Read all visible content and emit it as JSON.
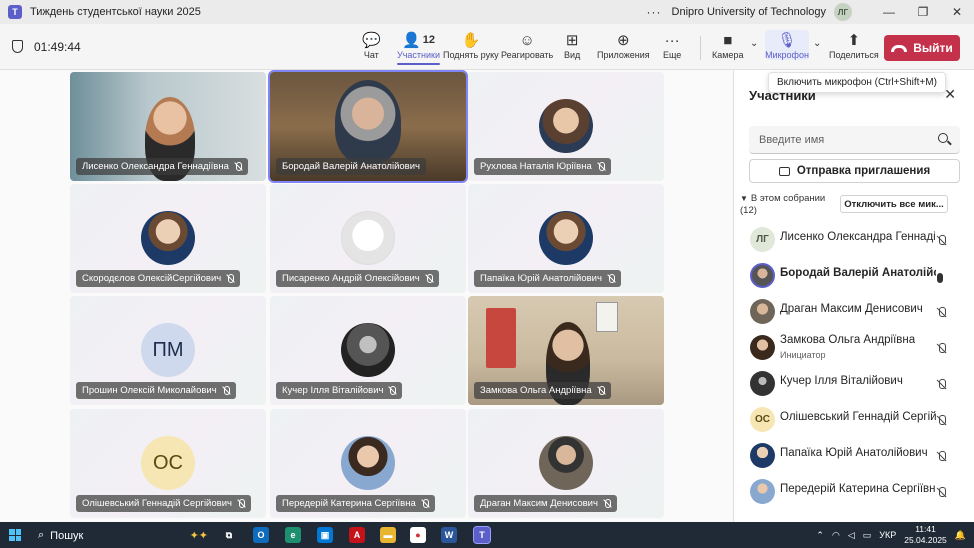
{
  "window": {
    "title": "Тиждень студентської науки 2025",
    "org": "Dnipro University of Technology",
    "user_initials": "ЛГ"
  },
  "toolbar": {
    "timer": "01:49:44",
    "chat": "Чат",
    "participants": "Участники",
    "participants_count": "12",
    "raise_hand": "Поднять руку",
    "react": "Реагировать",
    "view": "Вид",
    "apps": "Приложения",
    "more": "Еще",
    "camera": "Камера",
    "mic": "Микрофон",
    "share": "Поделиться",
    "leave": "Выйти"
  },
  "tooltip": "Включить микрофон (Ctrl+Shift+M)",
  "tiles": [
    {
      "name": "Лисенко Олександра Геннадіївна"
    },
    {
      "name": "Бородай Валерій Анатолійович"
    },
    {
      "name": "Рухлова Наталія Юріївна"
    },
    {
      "name": "Скородєлов ОлексійСергійович"
    },
    {
      "name": "Писаренко Андрій Олексійович"
    },
    {
      "name": "Папаїка Юрій Анатолійович"
    },
    {
      "name": "Прошин Олексій Миколайович",
      "initials": "ПМ"
    },
    {
      "name": "Кучер Ілля Віталійович"
    },
    {
      "name": "Замкова Ольга Андріївна"
    },
    {
      "name": "Олішевський Геннадій Сергійович",
      "initials": "ОС"
    },
    {
      "name": "Передерій Катерина Сергіївна"
    },
    {
      "name": "Драган Максим Денисович"
    }
  ],
  "panel": {
    "title": "Участники",
    "search_placeholder": "Введите имя",
    "invite": "Отправка приглашения",
    "section": "В этом собрании",
    "section_count": "(12)",
    "mute_all": "Отключить все мик...",
    "people": [
      {
        "name": "Лисенко Олександра Геннаді...",
        "initials": "ЛГ"
      },
      {
        "name": "Бородай Валерій Анатолійо..."
      },
      {
        "name": "Драган Максим Денисович"
      },
      {
        "name": "Замкова Ольга Андріївна",
        "role": "Инициатор"
      },
      {
        "name": "Кучер Ілля Віталійович"
      },
      {
        "name": "Олішевський Геннадій Сергій...",
        "initials": "ОС"
      },
      {
        "name": "Папаїка Юрій Анатолійович"
      },
      {
        "name": "Передерій Катерина Сергіївна"
      }
    ]
  },
  "taskbar": {
    "search": "Пошук",
    "lang": "УКР",
    "time": "11:41",
    "date": "25.04.2025"
  }
}
